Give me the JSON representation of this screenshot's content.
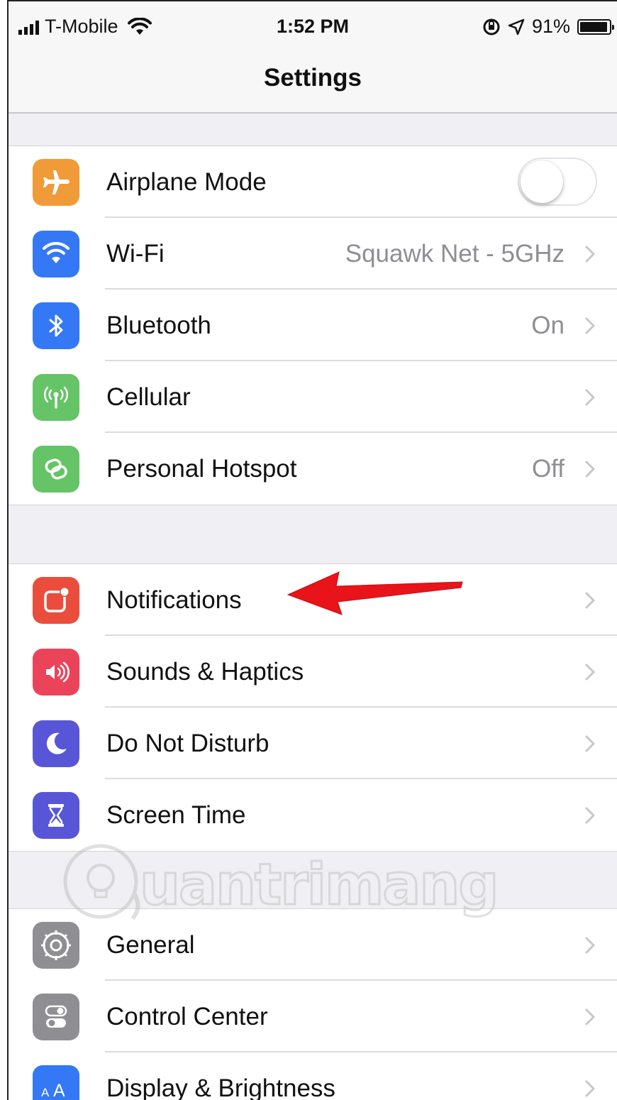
{
  "status_bar": {
    "carrier": "T-Mobile",
    "time": "1:52 PM",
    "battery": "91%",
    "battery_level": 0.91
  },
  "nav": {
    "title": "Settings"
  },
  "groups": [
    {
      "items": [
        {
          "label": "Airplane Mode",
          "icon": "airplane-icon",
          "color": "#f19a38",
          "control": "toggle",
          "toggle_on": false
        },
        {
          "label": "Wi-Fi",
          "icon": "wifi-icon",
          "color": "#3478f6",
          "value": "Squawk Net - 5GHz"
        },
        {
          "label": "Bluetooth",
          "icon": "bluetooth-icon",
          "color": "#3478f6",
          "value": "On"
        },
        {
          "label": "Cellular",
          "icon": "antenna-icon",
          "color": "#65c466"
        },
        {
          "label": "Personal Hotspot",
          "icon": "hotspot-chain-icon",
          "color": "#65c466",
          "value": "Off"
        }
      ]
    },
    {
      "items": [
        {
          "label": "Notifications",
          "icon": "notifications-icon",
          "color": "#eb4d3d"
        },
        {
          "label": "Sounds & Haptics",
          "icon": "speaker-icon",
          "color": "#eb445a"
        },
        {
          "label": "Do Not Disturb",
          "icon": "moon-icon",
          "color": "#5856d6"
        },
        {
          "label": "Screen Time",
          "icon": "hourglass-icon",
          "color": "#5856d6"
        }
      ]
    },
    {
      "items": [
        {
          "label": "General",
          "icon": "gear-icon",
          "color": "#8e8e93"
        },
        {
          "label": "Control Center",
          "icon": "switches-icon",
          "color": "#8e8e93"
        },
        {
          "label": "Display & Brightness",
          "icon": "text-size-icon",
          "color": "#3478f6"
        }
      ]
    }
  ],
  "annotation": {
    "arrow_color": "#e8141a",
    "points_to": "Notifications"
  },
  "watermark": {
    "text": "uantrimang"
  }
}
